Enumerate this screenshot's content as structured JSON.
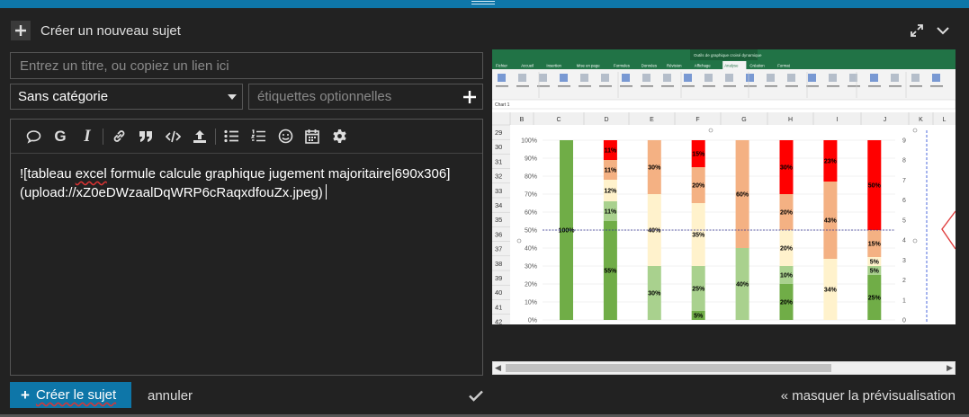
{
  "header": {
    "title": "Créer un nouveau sujet"
  },
  "form": {
    "title_placeholder": "Entrez un titre, ou copiez un lien ici",
    "title_value": "",
    "category_selected": "Sans catégorie",
    "tags_placeholder": "étiquettes optionnelles"
  },
  "editor": {
    "toolbar_icons": [
      "quote-bubble-icon",
      "bold-icon",
      "italic-icon",
      "link-icon",
      "blockquote-icon",
      "code-icon",
      "upload-icon",
      "bullet-list-icon",
      "numbered-list-icon",
      "emoji-icon",
      "calendar-icon",
      "gear-icon"
    ],
    "bold_glyph": "G",
    "italic_glyph": "I",
    "content_line1_a": "![tableau ",
    "content_line1_b": "excel",
    "content_line1_c": " formule calcule graphique jugement majoritaire|690x306]",
    "content_line2": "(upload://xZ0eDWzaalDqWRP6cRaqxdfouZx.jpeg)"
  },
  "footer": {
    "create_label": "Créer le sujet",
    "cancel_label": "annuler",
    "hide_preview_label": "« masquer la prévisualisation"
  },
  "preview": {
    "ribbon_tabs": [
      "Fichier",
      "Accueil",
      "Insertion",
      "Mise en page",
      "Formules",
      "Données",
      "Révision",
      "Affichage",
      "Analyse",
      "Création",
      "Format"
    ],
    "ribbon_title": "Outils de graphique croisé dynamique",
    "name_box": "Chart 1",
    "columns": [
      "B",
      "C",
      "D",
      "E",
      "F",
      "G",
      "H",
      "I",
      "J",
      "K",
      "L"
    ],
    "rows": [
      "29",
      "30",
      "31",
      "32",
      "33",
      "34",
      "35",
      "36",
      "37",
      "38",
      "39",
      "40",
      "41",
      "42"
    ],
    "y_ticks": [
      "100%",
      "90%",
      "80%",
      "70%",
      "60%",
      "50%",
      "40%",
      "30%",
      "20%",
      "10%",
      "0%"
    ],
    "y2_ticks": [
      "9",
      "8",
      "7",
      "6",
      "5",
      "4",
      "3",
      "2",
      "1",
      "0"
    ]
  },
  "chart_data": {
    "type": "bar",
    "stacked": true,
    "ylim": [
      0,
      100
    ],
    "y2lim": [
      0,
      9
    ],
    "reference_line": 50,
    "grid": true,
    "colors": [
      "#70ad47",
      "#a9d18e",
      "#fff2cc",
      "#f4b183",
      "#ff0000"
    ],
    "bars": [
      {
        "segments": [
          100,
          0,
          0,
          0,
          0
        ]
      },
      {
        "segments": [
          55,
          11,
          12,
          11,
          11
        ]
      },
      {
        "segments": [
          0,
          30,
          40,
          30,
          0
        ]
      },
      {
        "segments": [
          5,
          25,
          35,
          20,
          15
        ]
      },
      {
        "segments": [
          0,
          40,
          0,
          60,
          0
        ]
      },
      {
        "segments": [
          20,
          10,
          20,
          20,
          30
        ]
      },
      {
        "segments": [
          0,
          0,
          34,
          43,
          23
        ]
      },
      {
        "segments": [
          25,
          5,
          5,
          15,
          50
        ]
      }
    ],
    "labels": [
      [
        "100%"
      ],
      [
        "55%",
        "11%",
        "12%",
        "11%",
        "11%"
      ],
      [
        "30%",
        "40%",
        "30%"
      ],
      [
        "5%",
        "25%",
        "35%",
        "20%",
        "15%"
      ],
      [
        "40%",
        "60%"
      ],
      [
        "20%",
        "10%",
        "20%",
        "20%",
        "30%"
      ],
      [
        "34%",
        "43%",
        "23%"
      ],
      [
        "25%",
        "5%",
        "5%",
        "15%",
        "50%"
      ]
    ]
  }
}
